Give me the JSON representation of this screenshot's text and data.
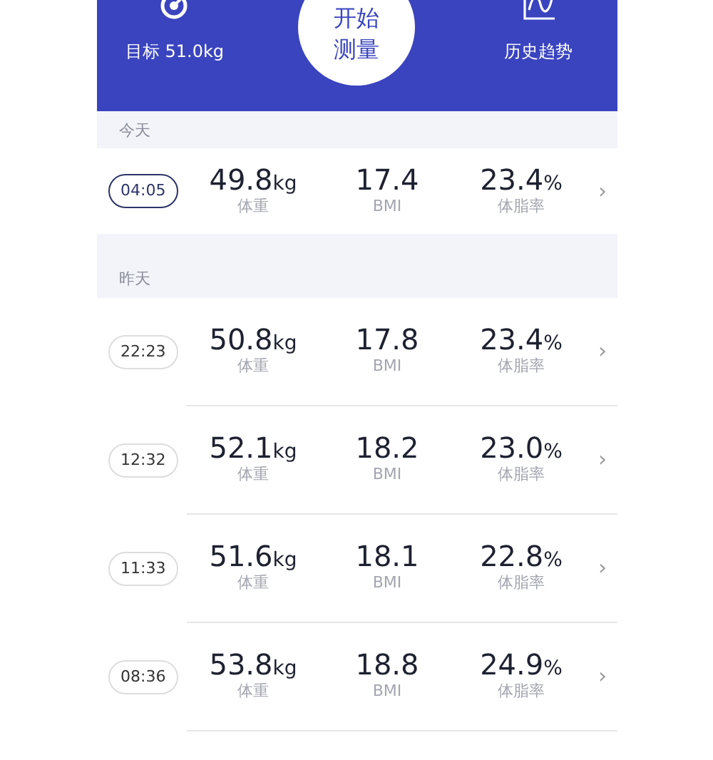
{
  "header": {
    "goal": "目标 51.0kg",
    "start_button": "开始测量",
    "trend": "历史趋势"
  },
  "sections": [
    {
      "label": "今天",
      "records": [
        {
          "time": "04:05",
          "selected": true,
          "weight": "49.8",
          "weight_unit": "kg",
          "weight_label": "体重",
          "bmi": "17.4",
          "bmi_label": "BMI",
          "fat": "23.4",
          "fat_unit": "%",
          "fat_label": "体脂率",
          "chevron": "›"
        }
      ]
    },
    {
      "label": "昨天",
      "records": [
        {
          "time": "22:23",
          "selected": false,
          "weight": "50.8",
          "weight_unit": "kg",
          "weight_label": "体重",
          "bmi": "17.8",
          "bmi_label": "BMI",
          "fat": "23.4",
          "fat_unit": "%",
          "fat_label": "体脂率",
          "chevron": "›"
        },
        {
          "time": "12:32",
          "selected": false,
          "weight": "52.1",
          "weight_unit": "kg",
          "weight_label": "体重",
          "bmi": "18.2",
          "bmi_label": "BMI",
          "fat": "23.0",
          "fat_unit": "%",
          "fat_label": "体脂率",
          "chevron": "›"
        },
        {
          "time": "11:33",
          "selected": false,
          "weight": "51.6",
          "weight_unit": "kg",
          "weight_label": "体重",
          "bmi": "18.1",
          "bmi_label": "BMI",
          "fat": "22.8",
          "fat_unit": "%",
          "fat_label": "体脂率",
          "chevron": "›"
        },
        {
          "time": "08:36",
          "selected": false,
          "weight": "53.8",
          "weight_unit": "kg",
          "weight_label": "体重",
          "bmi": "18.8",
          "bmi_label": "BMI",
          "fat": "24.9",
          "fat_unit": "%",
          "fat_label": "体脂率",
          "chevron": "›"
        }
      ]
    }
  ]
}
